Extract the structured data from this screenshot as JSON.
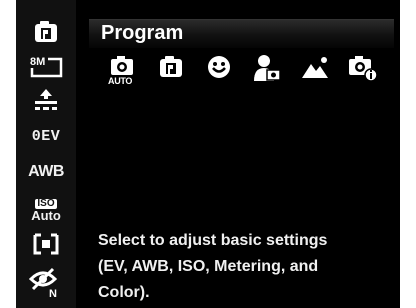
{
  "sidebar": {
    "items": [
      {
        "name": "program-mode-icon"
      },
      {
        "label": "8M",
        "name": "image-size-icon"
      },
      {
        "name": "quality-icon"
      },
      {
        "label": "0EV",
        "name": "exposure-item"
      },
      {
        "label": "AWB",
        "name": "white-balance-item"
      },
      {
        "label_top": "ISO",
        "label_bottom": "Auto",
        "name": "iso-item"
      },
      {
        "name": "metering-icon"
      },
      {
        "name": "color-mode-icon"
      }
    ]
  },
  "header": {
    "title": "Program"
  },
  "modes": [
    {
      "name": "auto-mode-icon",
      "label": "AUTO"
    },
    {
      "name": "program-mode-icon"
    },
    {
      "name": "smile-capture-icon"
    },
    {
      "name": "portrait-mode-icon"
    },
    {
      "name": "landscape-mode-icon"
    },
    {
      "name": "scene-info-mode-icon"
    }
  ],
  "description": {
    "line1": "Select to adjust basic settings",
    "line2": "(EV, AWB, ISO, Metering, and",
    "line3": "Color)."
  },
  "colors": {
    "background": "#000000",
    "sidebar": "#111111",
    "text": "#ffffff"
  }
}
